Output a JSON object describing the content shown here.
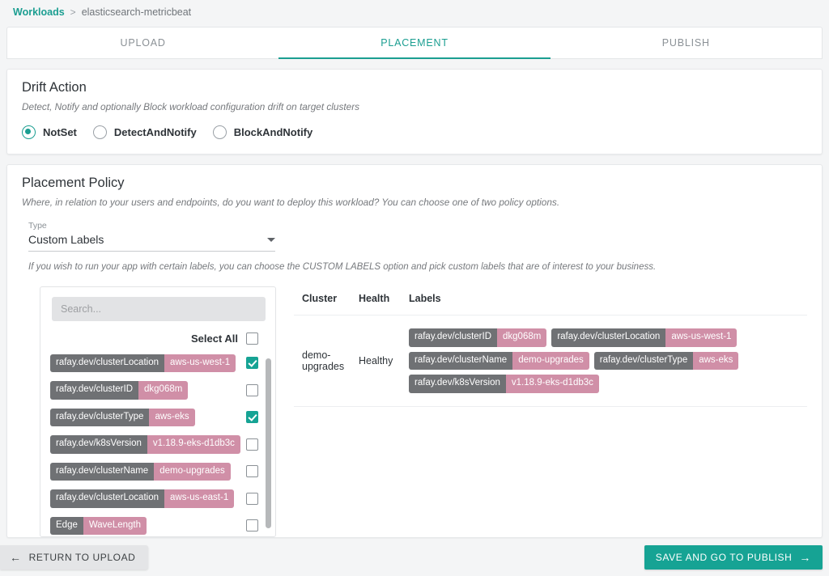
{
  "breadcrumb": {
    "root": "Workloads",
    "separator": ">",
    "current": "elasticsearch-metricbeat"
  },
  "tabs": [
    {
      "label": "UPLOAD",
      "active": false
    },
    {
      "label": "PLACEMENT",
      "active": true
    },
    {
      "label": "PUBLISH",
      "active": false
    }
  ],
  "drift_action": {
    "title": "Drift Action",
    "description": "Detect, Notify and optionally Block workload configuration drift on target clusters",
    "options": [
      {
        "label": "NotSet",
        "selected": true
      },
      {
        "label": "DetectAndNotify",
        "selected": false
      },
      {
        "label": "BlockAndNotify",
        "selected": false
      }
    ]
  },
  "placement_policy": {
    "title": "Placement Policy",
    "description": "Where, in relation to your users and endpoints, do you want to deploy this workload? You can choose one of two policy options.",
    "type_field": {
      "label": "Type",
      "value": "Custom Labels"
    },
    "help_text": "If you wish to run your app with certain labels, you can choose the CUSTOM LABELS option and pick custom labels that are of interest to your business."
  },
  "label_picker": {
    "search_placeholder": "Search...",
    "search_value": "",
    "select_all_label": "Select All",
    "select_all_checked": false,
    "labels": [
      {
        "key": "rafay.dev/clusterLocation",
        "value": "aws-us-west-1",
        "checked": true
      },
      {
        "key": "rafay.dev/clusterID",
        "value": "dkg068m",
        "checked": false
      },
      {
        "key": "rafay.dev/clusterType",
        "value": "aws-eks",
        "checked": true
      },
      {
        "key": "rafay.dev/k8sVersion",
        "value": "v1.18.9-eks-d1db3c",
        "checked": false
      },
      {
        "key": "rafay.dev/clusterName",
        "value": "demo-upgrades",
        "checked": false
      },
      {
        "key": "rafay.dev/clusterLocation",
        "value": "aws-us-east-1",
        "checked": false
      },
      {
        "key": "Edge",
        "value": "WaveLength",
        "checked": false
      }
    ]
  },
  "cluster_table": {
    "columns": [
      "Cluster",
      "Health",
      "Labels"
    ],
    "rows": [
      {
        "cluster": "demo-upgrades",
        "health": "Healthy",
        "labels": [
          {
            "key": "rafay.dev/clusterID",
            "value": "dkg068m"
          },
          {
            "key": "rafay.dev/clusterLocation",
            "value": "aws-us-west-1"
          },
          {
            "key": "rafay.dev/clusterName",
            "value": "demo-upgrades"
          },
          {
            "key": "rafay.dev/clusterType",
            "value": "aws-eks"
          },
          {
            "key": "rafay.dev/k8sVersion",
            "value": "v1.18.9-eks-d1db3c"
          }
        ]
      }
    ]
  },
  "footer": {
    "back_label": "RETURN TO UPLOAD",
    "back_icon": "arrow-left-icon",
    "next_label": "SAVE AND GO TO PUBLISH",
    "next_icon": "arrow-right-icon"
  },
  "colors": {
    "accent_teal": "#16a394",
    "chip_key": "#6f7174",
    "chip_value": "#d08fa7",
    "page_bg": "#f4f5f6"
  }
}
